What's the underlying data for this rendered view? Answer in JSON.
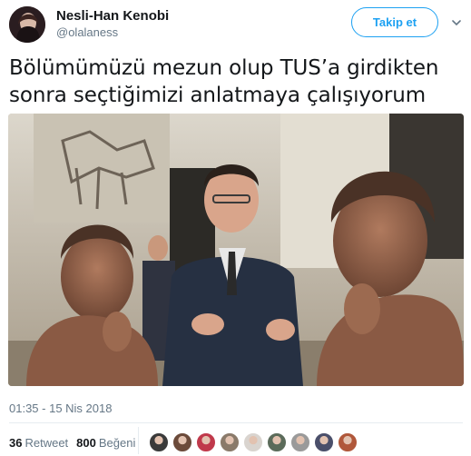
{
  "tweet": {
    "display_name": "Nesli-Han Kenobi",
    "handle": "@olalaness",
    "follow_label": "Takip et",
    "text_line1": "Bölümümüzü mezun olup TUS’a girdikten",
    "text_line2": "sonra seçtiğimizi anlatmaya çalışıyorum",
    "timestamp": "01:35 - 15 Nis 2018",
    "retweet_count": "36",
    "retweet_label": "Retweet",
    "like_count": "800",
    "like_label": "Beğeni"
  },
  "colors": {
    "accent": "#1da1f2",
    "secondary_text": "#657786"
  },
  "icons": {
    "caret": "chevron-down-icon"
  },
  "likers": [
    {
      "color": "#3a3a3a"
    },
    {
      "color": "#6b4a3a"
    },
    {
      "color": "#c0394b"
    },
    {
      "color": "#8a7a6a"
    },
    {
      "color": "#d9d4cf"
    },
    {
      "color": "#5b6b5a"
    },
    {
      "color": "#9a9a9a"
    },
    {
      "color": "#4a4f6a"
    },
    {
      "color": "#b0573a"
    }
  ]
}
